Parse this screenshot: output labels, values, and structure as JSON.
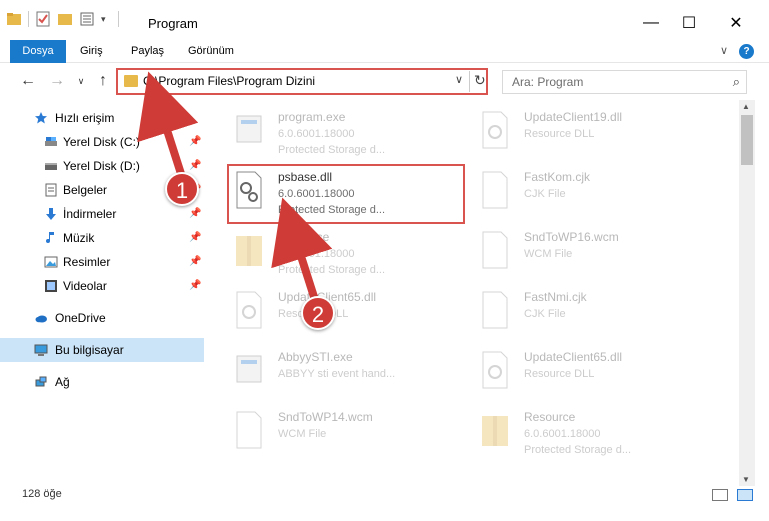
{
  "window": {
    "title": "Program",
    "controls": {
      "minimize": "—",
      "maximize": "☐",
      "close": "✕"
    }
  },
  "menu": {
    "items": [
      "Dosya",
      "Giriş",
      "Paylaş",
      "Görünüm"
    ],
    "chevron": "∨",
    "help": "?"
  },
  "nav": {
    "back": "←",
    "forward": "→",
    "history": "∨",
    "up": "↑"
  },
  "address": {
    "path": "C:\\Program Files\\Program Dizini",
    "dropdown": "∨",
    "refresh": "↻"
  },
  "search": {
    "placeholder": "Ara: Program",
    "icon": "⌕"
  },
  "sidebar": {
    "items": [
      {
        "label": "Hızlı erişim",
        "icon": "star-icon",
        "pinned": false
      },
      {
        "label": "Yerel Disk (C:)",
        "icon": "drive-icon",
        "pinned": true
      },
      {
        "label": "Yerel Disk (D:)",
        "icon": "drive-icon",
        "pinned": true
      },
      {
        "label": "Belgeler",
        "icon": "documents-icon",
        "pinned": true
      },
      {
        "label": "İndirmeler",
        "icon": "download-icon",
        "pinned": true
      },
      {
        "label": "Müzik",
        "icon": "music-icon",
        "pinned": true
      },
      {
        "label": "Resimler",
        "icon": "pictures-icon",
        "pinned": true
      },
      {
        "label": "Videolar",
        "icon": "videos-icon",
        "pinned": true
      },
      {
        "label": "OneDrive",
        "icon": "cloud-icon",
        "pinned": false
      },
      {
        "label": "Bu bilgisayar",
        "icon": "computer-icon",
        "pinned": false
      },
      {
        "label": "Ağ",
        "icon": "network-icon",
        "pinned": false
      }
    ],
    "pin_glyph": "📌"
  },
  "files": [
    {
      "name": "program.exe",
      "line1": "6.0.6001.18000",
      "line2": "Protected Storage d...",
      "icon": "exe-icon"
    },
    {
      "name": "UpdateClient19.dll",
      "line1": "Resource DLL",
      "line2": "",
      "icon": "dll-icon"
    },
    {
      "name": "psbase.dll",
      "line1": "6.0.6001.18000",
      "line2": "Protected Storage d...",
      "icon": "dll-gear-icon"
    },
    {
      "name": "FastKom.cjk",
      "line1": "CJK File",
      "line2": "",
      "icon": "file-icon"
    },
    {
      "name": "Resource",
      "line1": "6.0.6001.18000",
      "line2": "Protected Storage d...",
      "icon": "archive-icon"
    },
    {
      "name": "SndToWP16.wcm",
      "line1": "WCM File",
      "line2": "",
      "icon": "file-icon"
    },
    {
      "name": "UpdateClient65.dll",
      "line1": "Resource DLL",
      "line2": "",
      "icon": "dll-icon"
    },
    {
      "name": "FastNmi.cjk",
      "line1": "CJK File",
      "line2": "",
      "icon": "file-icon"
    },
    {
      "name": "AbbyySTI.exe",
      "line1": "ABBYY sti event hand...",
      "line2": "",
      "icon": "exe-icon"
    },
    {
      "name": "UpdateClient65.dll",
      "line1": "Resource DLL",
      "line2": "",
      "icon": "dll-icon"
    },
    {
      "name": "SndToWP14.wcm",
      "line1": "WCM File",
      "line2": "",
      "icon": "file-icon"
    },
    {
      "name": "Resource",
      "line1": "6.0.6001.18000",
      "line2": "Protected Storage d...",
      "icon": "archive-icon"
    }
  ],
  "status": {
    "count": "128 öğe"
  },
  "badges": [
    "1",
    "2"
  ],
  "colors": {
    "accent": "#1979ca",
    "highlight": "#d9534f",
    "selected": "#cce4f7"
  }
}
